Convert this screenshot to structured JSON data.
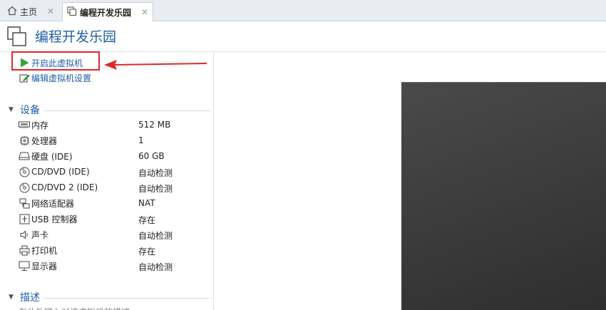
{
  "tabs": [
    {
      "label": "主页",
      "icon": "home-icon"
    },
    {
      "label": "编程开发乐园",
      "icon": "vm-icon",
      "active": true
    }
  ],
  "header": {
    "title": "编程开发乐园",
    "icon": "vm-icon"
  },
  "actions": {
    "start": {
      "label": "开启此虚拟机",
      "icon": "play-icon"
    },
    "edit": {
      "label": "编辑虚拟机设置",
      "icon": "edit-settings-icon"
    }
  },
  "sections": {
    "devices": "设备",
    "description": "描述"
  },
  "devices": [
    {
      "icon": "memory-icon",
      "name": "内存",
      "value": "512 MB"
    },
    {
      "icon": "processor-icon",
      "name": "处理器",
      "value": "1"
    },
    {
      "icon": "hard-disk-icon",
      "name": "硬盘 (IDE)",
      "value": "60 GB"
    },
    {
      "icon": "cd-dvd-icon",
      "name": "CD/DVD (IDE)",
      "value": "自动检测"
    },
    {
      "icon": "cd-dvd-icon",
      "name": "CD/DVD 2 (IDE)",
      "value": "自动检测"
    },
    {
      "icon": "network-adapter-icon",
      "name": "网络适配器",
      "value": "NAT"
    },
    {
      "icon": "usb-controller-icon",
      "name": "USB 控制器",
      "value": "存在"
    },
    {
      "icon": "sound-card-icon",
      "name": "声卡",
      "value": "自动检测"
    },
    {
      "icon": "printer-icon",
      "name": "打印机",
      "value": "存在"
    },
    {
      "icon": "display-icon",
      "name": "显示器",
      "value": "自动检测"
    }
  ],
  "description_text": "在此处键入对该虚拟机的描述。",
  "colors": {
    "accent": "#1e5fa8",
    "highlight": "#e02828",
    "play": "#3aa236"
  }
}
